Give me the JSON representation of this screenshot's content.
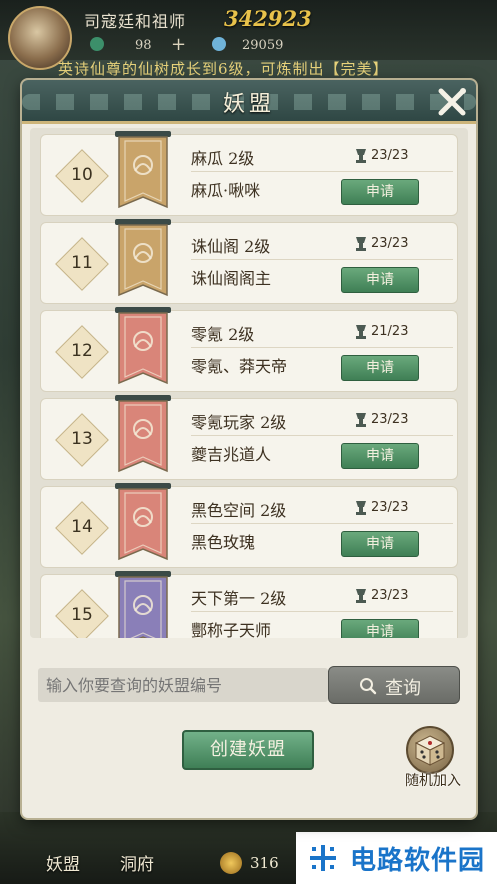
{
  "hud": {
    "player_name": "司寇廷和祖师",
    "power": "342923",
    "stat_a": "98",
    "stat_b": "29059",
    "marquee": "英诗仙尊的仙树成长到6级，可炼制出【完美】"
  },
  "panel": {
    "title": "妖盟"
  },
  "guilds": [
    {
      "rank": "10",
      "name": "麻瓜  2级",
      "leader": "麻瓜·啾咪",
      "members": "23/23",
      "apply": "申请",
      "banner": "gold"
    },
    {
      "rank": "11",
      "name": "诛仙阁  2级",
      "leader": "诛仙阁阁主",
      "members": "23/23",
      "apply": "申请",
      "banner": "gold"
    },
    {
      "rank": "12",
      "name": "零氪  2级",
      "leader": "零氪、莽天帝",
      "members": "21/23",
      "apply": "申请",
      "banner": "red"
    },
    {
      "rank": "13",
      "name": "零氪玩家  2级",
      "leader": "夔吉兆道人",
      "members": "23/23",
      "apply": "申请",
      "banner": "red"
    },
    {
      "rank": "14",
      "name": "黑色空间  2级",
      "leader": "黑色玫瑰",
      "members": "23/23",
      "apply": "申请",
      "banner": "red"
    },
    {
      "rank": "15",
      "name": "天下第一  2级",
      "leader": "酆称子天师",
      "members": "23/23",
      "apply": "申请",
      "banner": "purple"
    }
  ],
  "search": {
    "placeholder": "输入你要查询的妖盟编号",
    "button_label": "查询"
  },
  "actions": {
    "create_label": "创建妖盟",
    "random_join_label": "随机加入"
  },
  "bottom_nav": {
    "item1": "妖盟",
    "item2": "洞府",
    "coins": "316"
  },
  "watermark": {
    "text": "电路软件园"
  },
  "colors": {
    "banner_gold": "#c9a46a",
    "banner_red": "#d98579",
    "banner_purple": "#8a7fb8",
    "apply_green": "#4f8f65",
    "header_teal": "#3d5653"
  }
}
